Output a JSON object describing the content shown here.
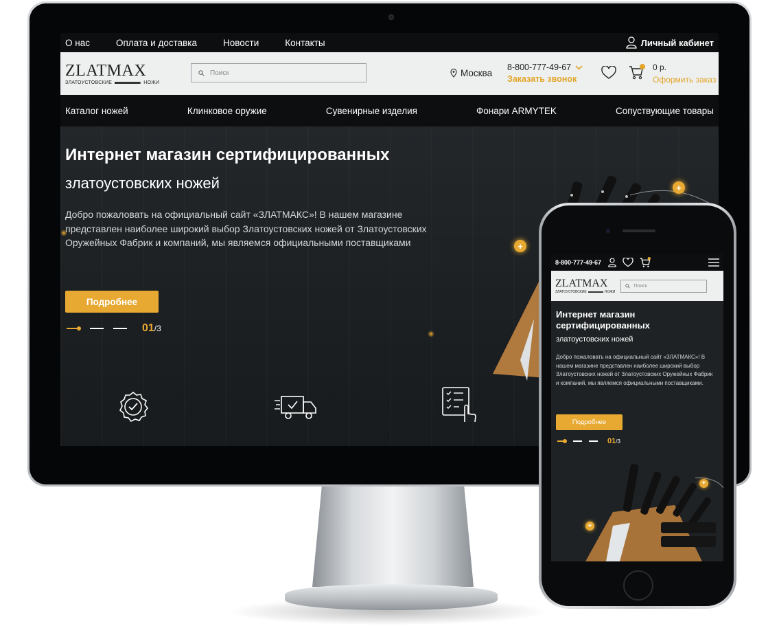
{
  "desktop": {
    "topbar": {
      "items": [
        "О нас",
        "Оплата и доставка",
        "Новости",
        "Контакты"
      ],
      "cabinet": "Личный кабинет"
    },
    "header": {
      "logo_main": "ZLATMAX",
      "logo_sub_left": "ЗЛАТОУСТОВСКИЕ",
      "logo_sub_right": "НОЖИ",
      "search_placeholder": "Поиск",
      "city": "Москва",
      "phone": "8-800-777-49-67",
      "callback": "Заказать звонок",
      "cart_sum": "0 р.",
      "cart_order": "Оформить заказ"
    },
    "catnav": [
      "Каталог ножей",
      "Клинковое оружие",
      "Сувенирные изделия",
      "Фонари ARMYTEK",
      "Сопуствующие товары"
    ],
    "hero": {
      "title": "Интернет магазин сертифицированных",
      "subtitle": "златоустовских ножей",
      "text": "Добро пожаловать на официальный сайт «ЗЛАТМАКС»! В нашем магазине представлен наиболее широкий выбор Златоустовских ножей от Златоустовских Оружейных Фабрик и компаний, мы являемся официальными поставщиками",
      "button": "Подробнее",
      "slide_current": "01",
      "slide_total": "/3"
    },
    "features": [
      "badge-check-icon",
      "delivery-truck-icon",
      "checklist-hand-icon"
    ]
  },
  "mobile": {
    "phone": "8-800-777-49-67",
    "logo_main": "ZLATMAX",
    "logo_sub_left": "ЗЛАТОУСТОВСКИЕ",
    "logo_sub_right": "НОЖИ",
    "search_placeholder": "Поиск",
    "title": "Интернет магазин сертифицированных",
    "subtitle": "златоустовских ножей",
    "text": "Добро пожаловать на официальный сайт «ЗЛАТМАКС»! В нашем магазине представлен наиболее широкий выбор Златоустовских ножей от Златоустовских Оружейных Фабрик и компаний, мы являемся официальными поставщиками.",
    "button": "Подробнее",
    "slide_current": "01",
    "slide_total": "/3"
  },
  "colors": {
    "accent": "#e8a932",
    "dark": "#0d0e0f",
    "header_bg": "#eef0f0"
  }
}
